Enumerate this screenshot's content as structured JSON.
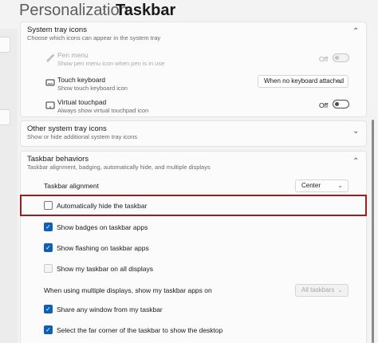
{
  "header": {
    "parent": "Personalization",
    "separator": "›",
    "current": "Taskbar"
  },
  "tray_icons": {
    "title": "System tray icons",
    "description": "Choose which icons can appear in the system tray",
    "items": [
      {
        "label": "Pen menu",
        "description": "Show pen menu icon when pen is in use",
        "state": "Off",
        "enabled": false,
        "icon": "pen-icon"
      },
      {
        "label": "Touch keyboard",
        "description": "Show touch keyboard icon",
        "dropdown": "When no keyboard attached",
        "icon": "keyboard-icon"
      },
      {
        "label": "Virtual touchpad",
        "description": "Always show virtual touchpad icon",
        "state": "Off",
        "enabled": true,
        "icon": "touchpad-icon"
      }
    ]
  },
  "other_tray": {
    "title": "Other system tray icons",
    "description": "Show or hide additional system tray icons"
  },
  "behaviors": {
    "title": "Taskbar behaviors",
    "description": "Taskbar alignment, badging, automatically hide, and multiple displays",
    "alignment_label": "Taskbar alignment",
    "alignment_value": "Center",
    "autohide_label": "Automatically hide the taskbar",
    "badges_label": "Show badges on taskbar apps",
    "flashing_label": "Show flashing on taskbar apps",
    "all_displays_label": "Show my taskbar on all displays",
    "multi_display_label": "When using multiple displays, show my taskbar apps on",
    "multi_display_value": "All taskbars",
    "share_window_label": "Share any window from my taskbar",
    "far_corner_label": "Select the far corner of the taskbar to show the desktop"
  },
  "icons": {
    "chevron_up": "chevron-up-icon",
    "chevron_down": "chevron-down-icon",
    "check": "checkmark-icon"
  },
  "colors": {
    "accent": "#0f5fb4",
    "highlight": "#a31c1c"
  }
}
